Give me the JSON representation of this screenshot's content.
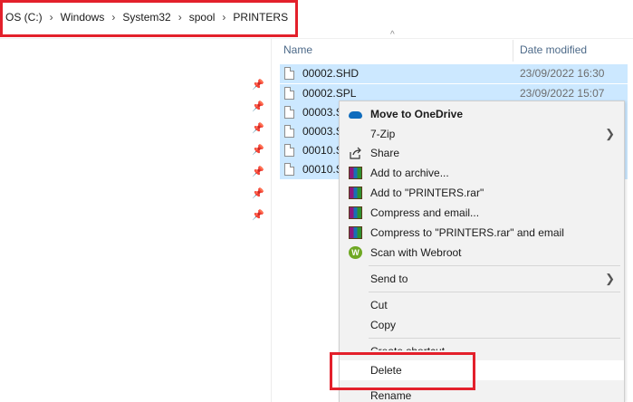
{
  "breadcrumb": [
    "OS (C:)",
    "Windows",
    "System32",
    "spool",
    "PRINTERS"
  ],
  "columns": {
    "name": "Name",
    "date": "Date modified"
  },
  "files": [
    {
      "name": "00002.SHD",
      "date": "23/09/2022 16:30"
    },
    {
      "name": "00002.SPL",
      "date": "23/09/2022 15:07"
    },
    {
      "name": "00003.S",
      "date": ""
    },
    {
      "name": "00003.S",
      "date": ""
    },
    {
      "name": "00010.S",
      "date": ""
    },
    {
      "name": "00010.S",
      "date": ""
    }
  ],
  "context_menu": {
    "move_onedrive": "Move to OneDrive",
    "seven_zip": "7-Zip",
    "share": "Share",
    "add_archive": "Add to archive...",
    "add_rar": "Add to \"PRINTERS.rar\"",
    "compress_email": "Compress and email...",
    "compress_rar_email": "Compress to \"PRINTERS.rar\" and email",
    "scan_webroot": "Scan with Webroot",
    "send_to": "Send to",
    "cut": "Cut",
    "copy": "Copy",
    "create_shortcut": "Create shortcut",
    "delete": "Delete",
    "rename": "Rename"
  },
  "colors": {
    "highlight_box": "#e3202b",
    "selection": "#cce8ff",
    "menu_bg": "#f2f2f2",
    "onedrive": "#0f6cbd"
  }
}
